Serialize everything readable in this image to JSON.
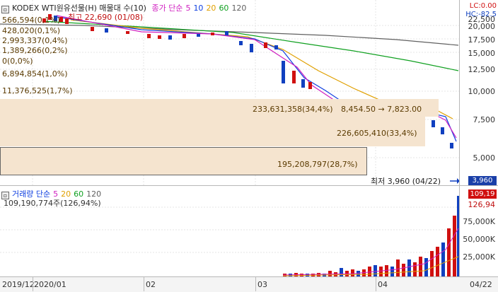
{
  "price_legend": {
    "title": "KODEX WTI원유선물(H) 매물대 수(10)",
    "ma_prefix": "종가 단순",
    "ma": [
      "5",
      "10",
      "20",
      "60",
      "120"
    ],
    "ma_colors": [
      "#d020c0",
      "#1040e0",
      "#e0a000",
      "#10a020",
      "#606060"
    ]
  },
  "corner": {
    "lc": "LC:0.00",
    "hc": "HC:-82.5"
  },
  "price_axis": [
    "22,500",
    "20,000",
    "17,500",
    "15,000",
    "12,500",
    "10,000",
    "7,500",
    "5,000"
  ],
  "volume_profile_labels": [
    "566,594(0,1%)",
    "428,020(0,1%)",
    "2,993,337(0,4%)",
    "1,389,266(0,2%)",
    "0(0,0%)",
    "6,894,854(1,0%)",
    "11,376,525(1,7%)",
    "233,631,358(34,4%)",
    "226,605,410(33,4%)",
    "195,208,797(28,7%)"
  ],
  "max_label": "최고 22,690 (01/08)",
  "mid_label": "8,454.50 → 7,823.00",
  "min_label": "최저 3,960 (04/22)",
  "last_price": "3,960",
  "vol_legend": {
    "title": "거래량 단순",
    "ma": [
      "5",
      "20",
      "60",
      "120"
    ],
    "ma_colors": [
      "#d020c0",
      "#e0a000",
      "#10a020",
      "#606060"
    ],
    "value": "109,190,774주(126,94%)"
  },
  "vol_axis": [
    "109,19",
    "126,94",
    "75,000K",
    "50,000K",
    "25,000K"
  ],
  "date_axis": [
    "2019/12",
    "2020/01",
    "02",
    "03",
    "04",
    "04/22"
  ]
}
